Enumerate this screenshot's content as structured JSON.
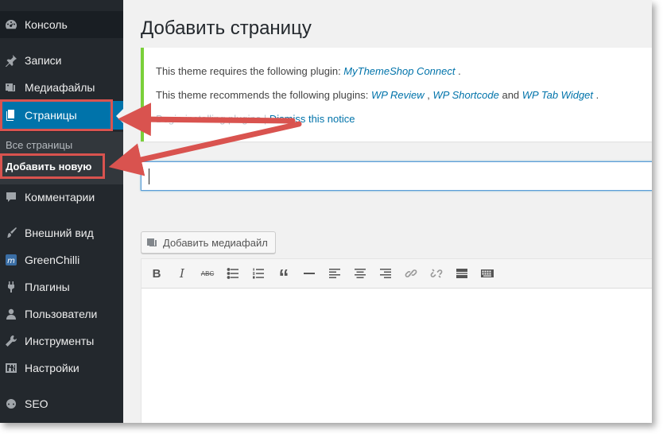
{
  "sidebar": {
    "items": [
      {
        "label": "Консоль",
        "icon": "dashboard-icon"
      },
      {
        "label": "Записи",
        "icon": "pin-icon"
      },
      {
        "label": "Медиафайлы",
        "icon": "media-icon"
      },
      {
        "label": "Страницы",
        "icon": "pages-icon"
      },
      {
        "label": "Комментарии",
        "icon": "comment-icon"
      },
      {
        "label": "Внешний вид",
        "icon": "brush-icon"
      },
      {
        "label": "GreenChilli",
        "icon": "theme-m-icon"
      },
      {
        "label": "Плагины",
        "icon": "plugin-icon"
      },
      {
        "label": "Пользователи",
        "icon": "user-icon"
      },
      {
        "label": "Инструменты",
        "icon": "wrench-icon"
      },
      {
        "label": "Настройки",
        "icon": "settings-icon"
      },
      {
        "label": "SEO",
        "icon": "seo-icon"
      }
    ],
    "submenu": {
      "all_pages": "Все страницы",
      "add_new": "Добавить новую"
    }
  },
  "page": {
    "title": "Добавить страницу"
  },
  "notice": {
    "line1_prefix": "This theme requires the following plugin: ",
    "line1_plugin": "MyThemeShop Connect",
    "line1_suffix": " .",
    "line2_prefix": "This theme recommends the following plugins: ",
    "line2_plugin1": "WP Review",
    "line2_sep1": " , ",
    "line2_plugin2": "WP Shortcode",
    "line2_and": " and ",
    "line2_plugin3": "WP Tab Widget",
    "line2_suffix": " .",
    "line3_partial": "Begin installing plugins | ",
    "line3_dismiss": "Dismiss this notice"
  },
  "title_input": {
    "value": ""
  },
  "media_button": {
    "label": "Добавить медиафайл"
  },
  "toolbar": {
    "buttons": [
      "bold-icon",
      "italic-icon",
      "strikethrough-icon",
      "bullet-list-icon",
      "numbered-list-icon",
      "blockquote-icon",
      "horizontal-line-icon",
      "align-left-icon",
      "align-center-icon",
      "align-right-icon",
      "link-icon",
      "unlink-icon",
      "read-more-icon",
      "toolbar-toggle-icon"
    ],
    "bold_label": "B",
    "italic_label": "I",
    "strike_label": "ABC",
    "quote_label": "“"
  },
  "colors": {
    "sidebar_bg": "#23282d",
    "accent": "#0073aa",
    "notice_border": "#7ad03a",
    "annotation_red": "#d9534f"
  }
}
